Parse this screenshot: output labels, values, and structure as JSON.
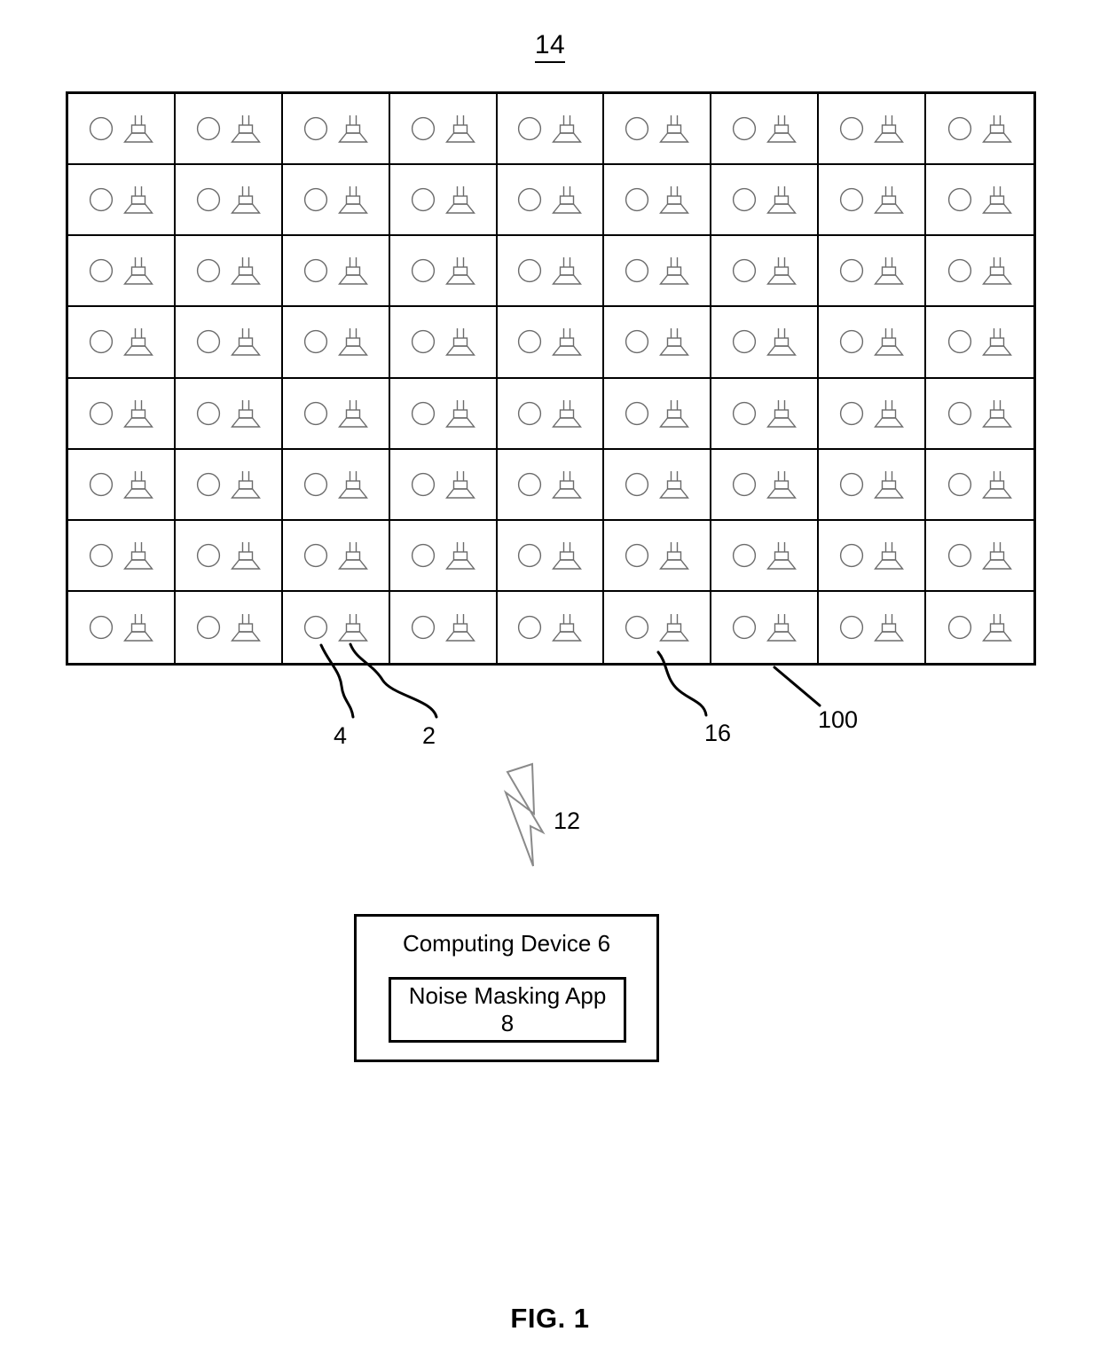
{
  "figure": {
    "caption": "FIG. 1",
    "top_reference": "14"
  },
  "grid": {
    "reference": "100",
    "columns": 9,
    "rows": 8,
    "cell_reference": "16",
    "cell_icons": [
      "microphone-circle-icon",
      "loudspeaker-icon"
    ],
    "speaker_reference": "2",
    "microphone_reference": "4"
  },
  "callouts": {
    "microphone": "4",
    "speaker": "2",
    "cell": "16",
    "array": "100",
    "wireless_link": "12",
    "top_system": "14"
  },
  "wireless_link": {
    "reference": "12",
    "icon": "lightning-bolt-icon"
  },
  "computing_device": {
    "label": "Computing Device 6",
    "app": {
      "label": "Noise Masking App\n8"
    }
  }
}
